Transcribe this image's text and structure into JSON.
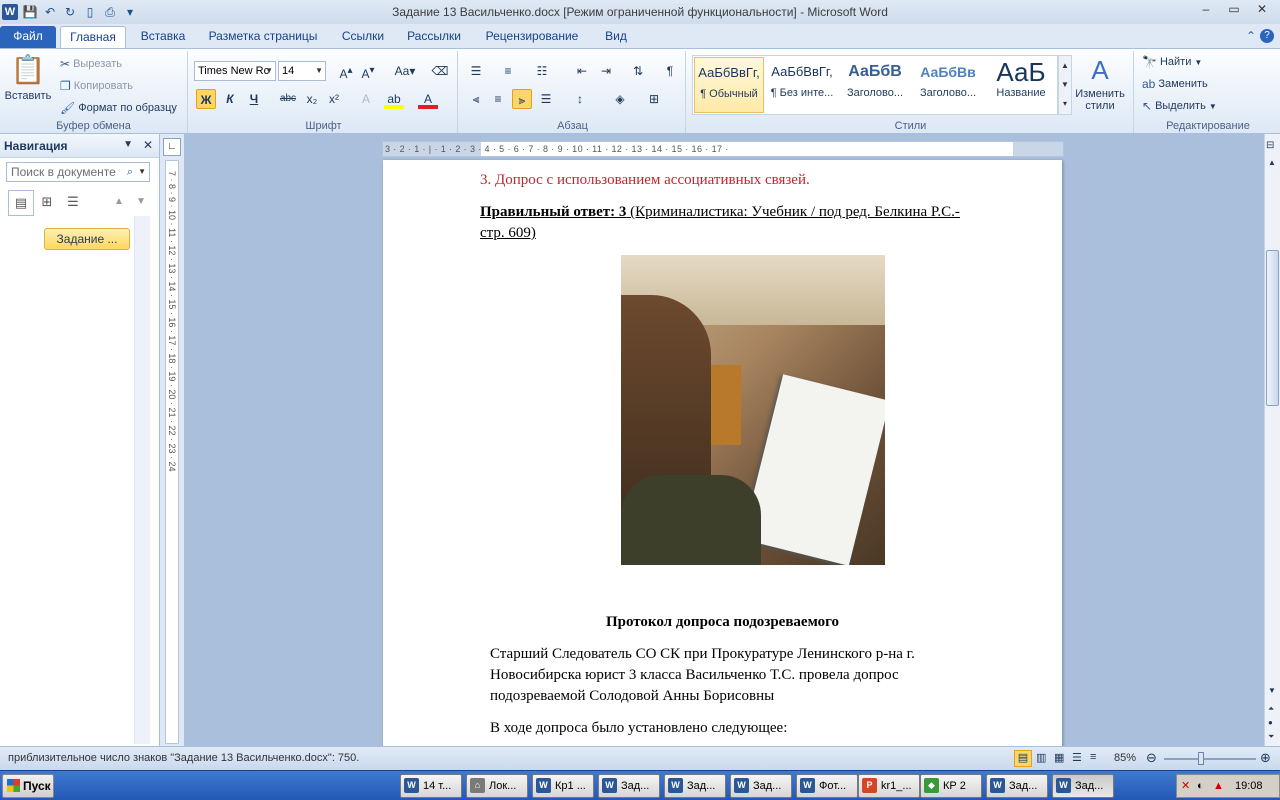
{
  "window": {
    "title": "Задание 13 Васильченко.docx [Режим ограниченной функциональности]  -  Microsoft Word"
  },
  "tabs": [
    {
      "label": "Файл"
    },
    {
      "label": "Главная"
    },
    {
      "label": "Вставка"
    },
    {
      "label": "Разметка страницы"
    },
    {
      "label": "Ссылки"
    },
    {
      "label": "Рассылки"
    },
    {
      "label": "Рецензирование"
    },
    {
      "label": "Вид"
    }
  ],
  "ribbon": {
    "clipboard": {
      "paste": "Вставить",
      "cut": "Вырезать",
      "copy": "Копировать",
      "format_painter": "Формат по образцу",
      "label": "Буфер обмена"
    },
    "font": {
      "name": "Times New Rc",
      "size": "14",
      "bold": "Ж",
      "italic": "К",
      "underline": "Ч",
      "strike": "abc",
      "sub": "x₂",
      "sup": "x²",
      "label": "Шрифт"
    },
    "paragraph": {
      "label": "Абзац"
    },
    "styles": {
      "items": [
        {
          "sample": "АаБбВвГг,",
          "name": "¶ Обычный"
        },
        {
          "sample": "АаБбВвГг,",
          "name": "¶ Без инте..."
        },
        {
          "sample": "АаБбВ",
          "name": "Заголово..."
        },
        {
          "sample": "АаБбВв",
          "name": "Заголово..."
        },
        {
          "sample": "АаБ",
          "name": "Название"
        }
      ],
      "change": "Изменить стили",
      "label": "Стили"
    },
    "editing": {
      "find": "Найти",
      "replace": "Заменить",
      "select": "Выделить",
      "label": "Редактирование"
    }
  },
  "nav": {
    "title": "Навигация",
    "search_placeholder": "Поиск в документе",
    "item": "Задание ..."
  },
  "ruler": {
    "h": "3 · 2 · 1 · | · 1 · 2 · 3 · 4 · 5 · 6 · 7 · 8 · 9 · 10 · 11 · 12 · 13 · 14 · 15 · 16 · 17 ·",
    "v": "7 · 8 · 9 · 10 · 11 · 12 · 13 · 14 · 15 · 16 · 17 · 18 · 19 · 20 · 21 · 22 · 23 · 24"
  },
  "document": {
    "option3": "3. Допрос с использованием ассоциативных связей.",
    "answer_bold": "Правильный ответ: 3",
    "answer_ref": " (Криминалистика: Учебник / под ред. Белкина Р.С.-",
    "answer_ref2": "стр. 609)",
    "heading": "Протокол допроса подозреваемого",
    "p1_line1": "Старший Следователь СО СК при  Прокуратуре Ленинского р-на г.",
    "p1_line2": "Новосибирска юрист 3 класса Васильченко Т.С.  провела допрос",
    "p1_line3": "подозреваемой Солодовой Анны Борисовны",
    "p2": "В ходе допроса было установлено следующее:",
    "option3_color": "#c0262d"
  },
  "status": {
    "text": "приблизительное число знаков \"Задание 13 Васильченко.docx\": 750.",
    "zoom": "85%"
  },
  "taskbar": {
    "start": "Пуск",
    "items": [
      {
        "label": "14 т...",
        "icon": "W"
      },
      {
        "label": "Лок...",
        "icon": "⌂"
      },
      {
        "label": "Кр1 ...",
        "icon": "W"
      },
      {
        "label": "Зад...",
        "icon": "W"
      },
      {
        "label": "Зад...",
        "icon": "W"
      },
      {
        "label": "Зад...",
        "icon": "W"
      },
      {
        "label": "Фот...",
        "icon": "W"
      },
      {
        "label": "kr1_...",
        "icon": "P"
      },
      {
        "label": "КР 2",
        "icon": "◆"
      },
      {
        "label": "Зад...",
        "icon": "W"
      },
      {
        "label": "Зад...",
        "icon": "W"
      }
    ],
    "time": "19:08"
  }
}
